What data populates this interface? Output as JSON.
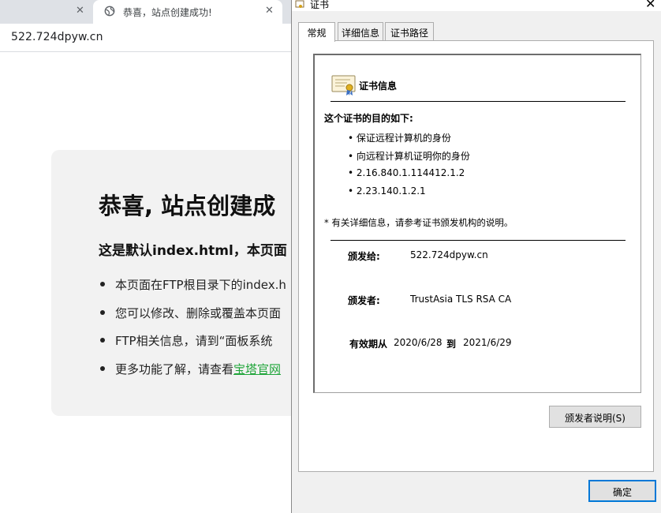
{
  "browser": {
    "tabs": [
      {
        "title": "",
        "close": "✕"
      },
      {
        "title": "恭喜，站点创建成功!",
        "close": "✕",
        "icon": "globe-icon"
      }
    ],
    "url": "522.724dpyw.cn"
  },
  "page": {
    "heading": "恭喜, 站点创建成",
    "subheading": "这是默认index.html，本页面",
    "items": [
      "本页面在FTP根目录下的index.h",
      "您可以修改、删除或覆盖本页面",
      "FTP相关信息，请到“面板系统",
      "更多功能了解，请查看"
    ],
    "link_text": "宝塔官网",
    "link_color": "#20a53a"
  },
  "dialog": {
    "title": "证书",
    "close": "✕",
    "tabs": [
      "常规",
      "详细信息",
      "证书路径"
    ],
    "info_title": "证书信息",
    "purpose_heading": "这个证书的目的如下:",
    "purposes": [
      "保证远程计算机的身份",
      "向远程计算机证明你的身份",
      "2.16.840.1.114412.1.2",
      "2.23.140.1.2.1"
    ],
    "footnote": "* 有关详细信息，请参考证书颁发机构的说明。",
    "issued_to_label": "颁发给:",
    "issued_to": "522.724dpyw.cn",
    "issued_by_label": "颁发者:",
    "issued_by": "TrustAsia TLS RSA CA",
    "validity_from_label": "有效期从",
    "valid_from": "2020/6/28",
    "validity_to_label": "到",
    "valid_to": "2021/6/29",
    "issuer_statement_button": "颁发者说明(S)",
    "ok_button": "确定",
    "accent_color": "#0078d7"
  }
}
